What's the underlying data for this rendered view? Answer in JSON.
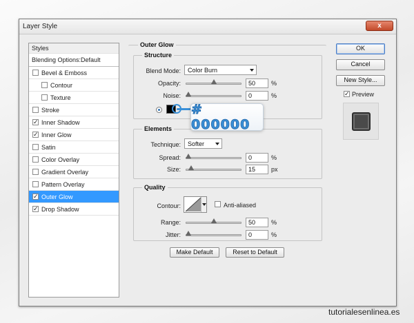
{
  "window": {
    "title": "Layer Style",
    "close_glyph": "x"
  },
  "styles_panel": {
    "header": "Styles",
    "blending_options": "Blending Options:Default",
    "items": [
      {
        "label": "Bevel & Emboss",
        "checked": false,
        "indent": false
      },
      {
        "label": "Contour",
        "checked": false,
        "indent": true
      },
      {
        "label": "Texture",
        "checked": false,
        "indent": true
      },
      {
        "label": "Stroke",
        "checked": false,
        "indent": false
      },
      {
        "label": "Inner Shadow",
        "checked": true,
        "indent": false
      },
      {
        "label": "Inner Glow",
        "checked": true,
        "indent": false
      },
      {
        "label": "Satin",
        "checked": false,
        "indent": false
      },
      {
        "label": "Color Overlay",
        "checked": false,
        "indent": false
      },
      {
        "label": "Gradient Overlay",
        "checked": false,
        "indent": false
      },
      {
        "label": "Pattern Overlay",
        "checked": false,
        "indent": false
      },
      {
        "label": "Outer Glow",
        "checked": true,
        "indent": false,
        "selected": true
      },
      {
        "label": "Drop Shadow",
        "checked": true,
        "indent": false
      }
    ]
  },
  "outer_glow": {
    "section_title": "Outer Glow",
    "structure": {
      "title": "Structure",
      "blend_mode_label": "Blend Mode:",
      "blend_mode_value": "Color Burn",
      "opacity_label": "Opacity:",
      "opacity_value": "50",
      "opacity_level": 0.5,
      "noise_label": "Noise:",
      "noise_value": "0",
      "noise_level": 0,
      "unit_percent": "%",
      "color": "#000000",
      "color_callout": "# 000000"
    },
    "elements": {
      "title": "Elements",
      "technique_label": "Technique:",
      "technique_value": "Softer",
      "spread_label": "Spread:",
      "spread_value": "0",
      "spread_level": 0,
      "size_label": "Size:",
      "size_value": "15",
      "size_level": 0.06,
      "unit_percent": "%",
      "unit_px": "px"
    },
    "quality": {
      "title": "Quality",
      "contour_label": "Contour:",
      "anti_aliased_label": "Anti-aliased",
      "anti_aliased_checked": false,
      "range_label": "Range:",
      "range_value": "50",
      "range_level": 0.5,
      "jitter_label": "Jitter:",
      "jitter_value": "0",
      "jitter_level": 0,
      "unit_percent": "%"
    },
    "make_default": "Make Default",
    "reset_default": "Reset to Default"
  },
  "buttons": {
    "ok": "OK",
    "cancel": "Cancel",
    "new_style": "New Style...",
    "preview_label": "Preview",
    "preview_checked": true
  },
  "watermark": "tutorialesenlinea.es"
}
